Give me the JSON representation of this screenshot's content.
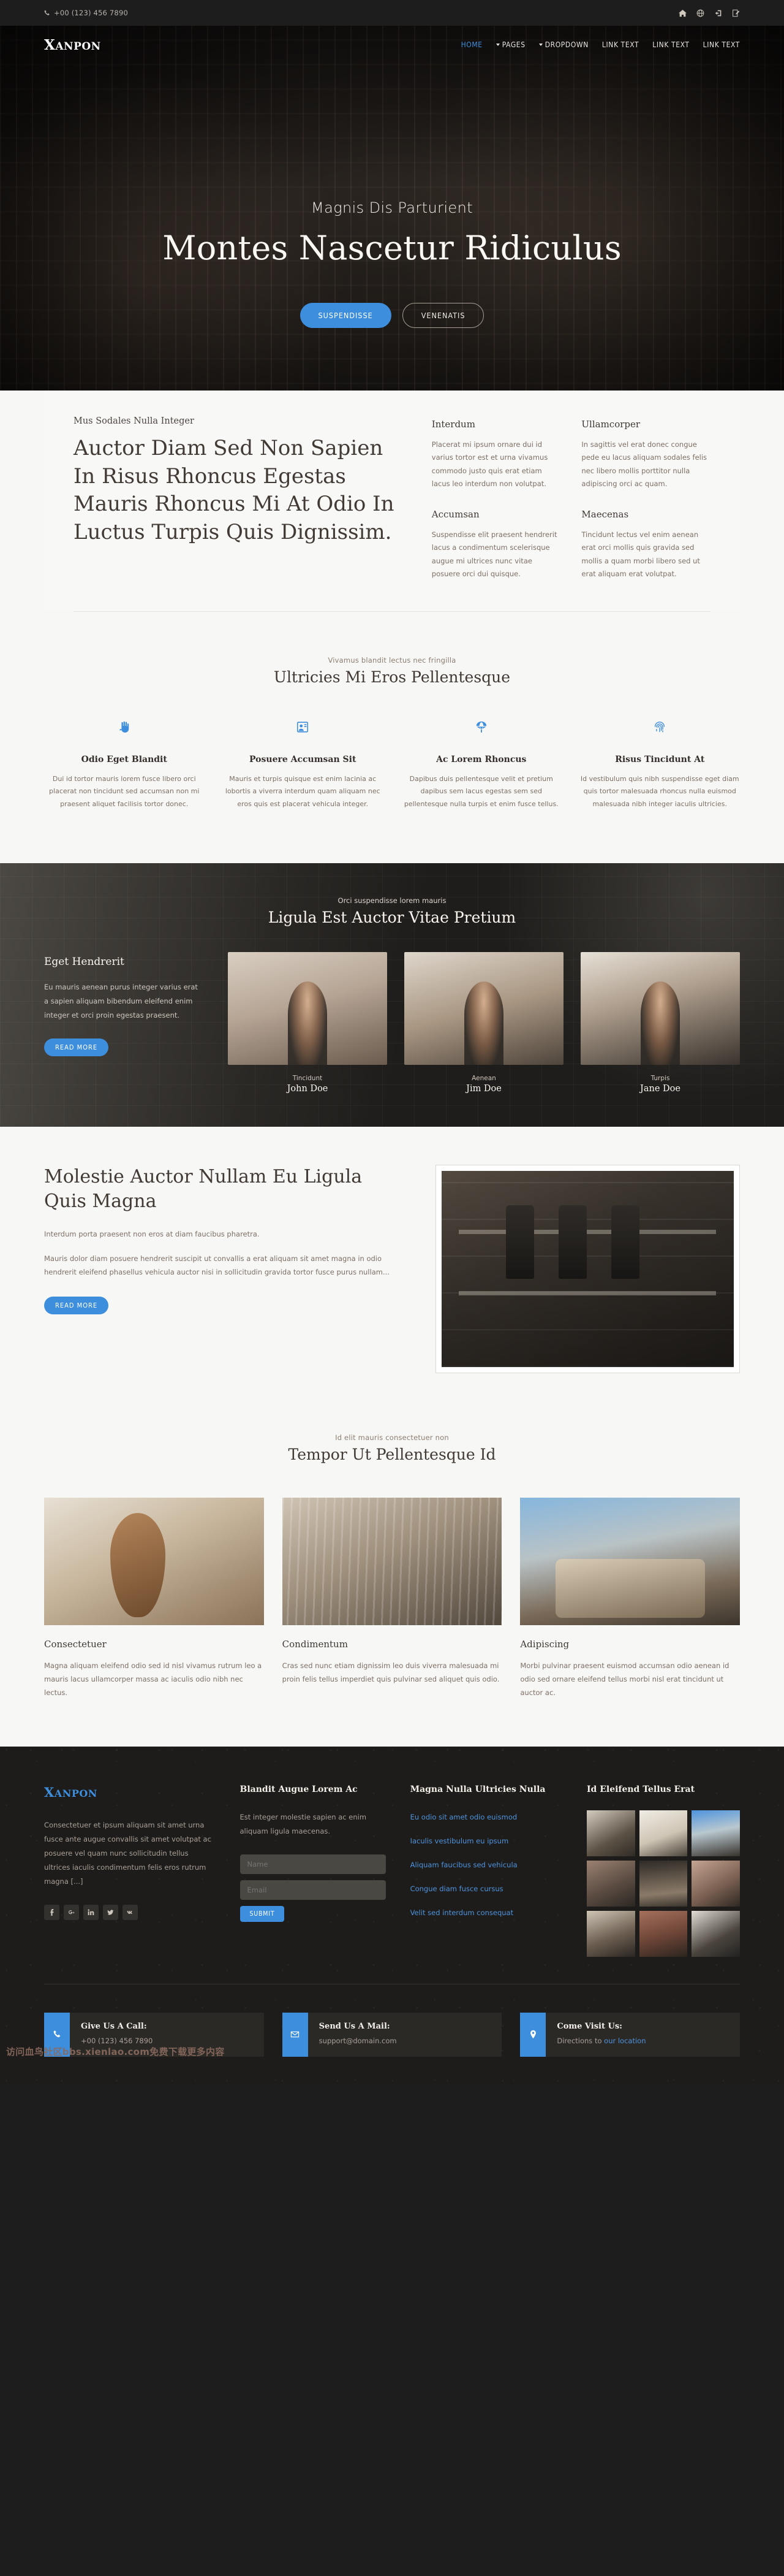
{
  "topbar": {
    "phone": "+00 (123) 456 7890",
    "icons": [
      "home-icon",
      "globe-icon",
      "login-icon",
      "register-icon"
    ]
  },
  "header": {
    "brand_first": "X",
    "brand_rest": "ANPON",
    "nav": [
      {
        "label": "HOME",
        "active": true,
        "caret": false
      },
      {
        "label": "PAGES",
        "active": false,
        "caret": true
      },
      {
        "label": "DROPDOWN",
        "active": false,
        "caret": true
      },
      {
        "label": "LINK TEXT",
        "active": false,
        "caret": false
      },
      {
        "label": "LINK TEXT",
        "active": false,
        "caret": false
      },
      {
        "label": "LINK TEXT",
        "active": false,
        "caret": false
      }
    ]
  },
  "hero": {
    "subtitle": "Magnis Dis Parturient",
    "title": "Montes Nascetur Ridiculus",
    "btn_primary": "SUSPENDISSE",
    "btn_secondary": "VENENATIS"
  },
  "intro_card": {
    "eyebrow": "Mus Sodales Nulla Integer",
    "heading": "Auctor Diam Sed Non Sapien In Risus Rhoncus Egestas Mauris Rhoncus Mi At Odio In Luctus Turpis Quis Dignissim.",
    "minis": [
      {
        "title": "Interdum",
        "text": "Placerat mi ipsum ornare dui id varius tortor est et urna vivamus commodo justo quis erat etiam lacus leo interdum non volutpat."
      },
      {
        "title": "Ullamcorper",
        "text": "In sagittis vel erat donec congue pede eu lacus aliquam sodales felis nec libero mollis porttitor nulla adipiscing orci ac quam."
      },
      {
        "title": "Accumsan",
        "text": "Suspendisse elit praesent hendrerit lacus a condimentum scelerisque augue mi ultrices nunc vitae posuere orci dui quisque."
      },
      {
        "title": "Maecenas",
        "text": "Tincidunt lectus vel enim aenean erat orci mollis quis gravida sed mollis a quam morbi libero sed ut erat aliquam erat volutpat."
      }
    ]
  },
  "features": {
    "eyebrow": "Vivamus blandit lectus nec fringilla",
    "title": "Ultricies Mi Eros Pellentesque",
    "items": [
      {
        "icon": "hand-icon",
        "title": "Odio Eget Blandit",
        "text": "Dui id tortor mauris lorem fusce libero orci placerat non tincidunt sed accumsan non mi praesent aliquet facilisis tortor donec."
      },
      {
        "icon": "user-card-icon",
        "title": "Posuere Accumsan Sit",
        "text": "Mauris et turpis quisque est enim lacinia ac lobortis a viverra interdum quam aliquam nec eros quis est placerat vehicula integer."
      },
      {
        "icon": "parachute-icon",
        "title": "Ac Lorem Rhoncus",
        "text": "Dapibus duis pellentesque velit et pretium dapibus sem lacus egestas sem sed pellentesque nulla turpis et enim fusce tellus."
      },
      {
        "icon": "fingerprint-icon",
        "title": "Risus Tincidunt At",
        "text": "Id vestibulum quis nibh suspendisse eget diam quis tortor malesuada rhoncus nulla euismod malesuada nibh integer iaculis ultricies."
      }
    ]
  },
  "team": {
    "eyebrow": "Orci suspendisse lorem mauris",
    "title": "Ligula Est Auctor Vitae Pretium",
    "intro_title": "Eget Hendrerit",
    "intro_text": "Eu mauris aenean purus integer varius erat a sapien aliquam bibendum eleifend enim integer et orci proin egestas praesent.",
    "intro_button": "READ MORE",
    "members": [
      {
        "role": "Tincidunt",
        "name": "John Doe"
      },
      {
        "role": "Aenean",
        "name": "Jim Doe"
      },
      {
        "role": "Turpis",
        "name": "Jane Doe"
      }
    ]
  },
  "about": {
    "heading": "Molestie Auctor Nullam Eu Ligula Quis Magna",
    "lead": "Interdum porta praesent non eros at diam faucibus pharetra.",
    "paragraph": "Mauris dolor diam posuere hendrerit suscipit ut convallis a erat aliquam sit amet magna in odio hendrerit eleifend phasellus vehicula auctor nisi in sollicitudin gravida tortor fusce purus nullam...",
    "button": "READ MORE"
  },
  "blog": {
    "eyebrow": "Id elit mauris consectetuer non",
    "title": "Tempor Ut Pellentesque Id",
    "posts": [
      {
        "title": "Consectetuer",
        "text": "Magna aliquam eleifend odio sed id nisl vivamus rutrum leo a mauris lacus ullamcorper massa ac iaculis odio nibh nec lectus."
      },
      {
        "title": "Condimentum",
        "text": "Cras sed nunc etiam dignissim leo duis viverra malesuada mi proin felis tellus imperdiet quis pulvinar sed aliquet quis odio."
      },
      {
        "title": "Adipiscing",
        "text": "Morbi pulvinar praesent euismod accumsan odio aenean id odio sed ornare eleifend tellus morbi nisl erat tincidunt ut auctor ac."
      }
    ]
  },
  "footer": {
    "brand_first": "X",
    "brand_rest": "ANPON",
    "description": "Consectetuer et ipsum aliquam sit amet urna fusce ante augue convallis sit amet volutpat ac posuere vel quam nunc sollicitudin tellus ultrices iaculis condimentum felis eros rutrum magna [...]",
    "socials": [
      "facebook-icon",
      "google-plus-icon",
      "linkedin-icon",
      "twitter-icon",
      "vk-icon"
    ],
    "form": {
      "heading": "Blandit Augue Lorem Ac",
      "text": "Est integer molestie sapien ac enim aliquam ligula maecenas.",
      "name_placeholder": "Name",
      "email_placeholder": "Email",
      "submit": "SUBMIT"
    },
    "links": {
      "heading": "Magna Nulla Ultricies Nulla",
      "items": [
        "Eu odio sit amet odio euismod",
        "Iaculis vestibulum eu ipsum",
        "Aliquam faucibus sed vehicula",
        "Congue diam fusce cursus",
        "Velit sed interdum consequat"
      ]
    },
    "gallery": {
      "heading": "Id Eleifend Tellus Erat",
      "thumbs": [
        "thumb-1",
        "thumb-2",
        "thumb-3",
        "thumb-4",
        "thumb-5",
        "thumb-6",
        "thumb-7",
        "thumb-8",
        "thumb-9"
      ]
    },
    "contacts": [
      {
        "icon": "phone-icon",
        "title": "Give Us A Call:",
        "text": "+00 (123) 456 7890",
        "link": ""
      },
      {
        "icon": "mail-icon",
        "title": "Send Us A Mail:",
        "text": "support@domain.com",
        "link": ""
      },
      {
        "icon": "pin-icon",
        "title": "Come Visit Us:",
        "text": "Directions to ",
        "link": "our location"
      }
    ],
    "watermark": "访问血鸟社区bbs.xienlao.com免费下载更多内容"
  },
  "colors": {
    "accent": "#3e8ede",
    "dark": "#1d1d1d",
    "light": "#f7f7f5"
  }
}
